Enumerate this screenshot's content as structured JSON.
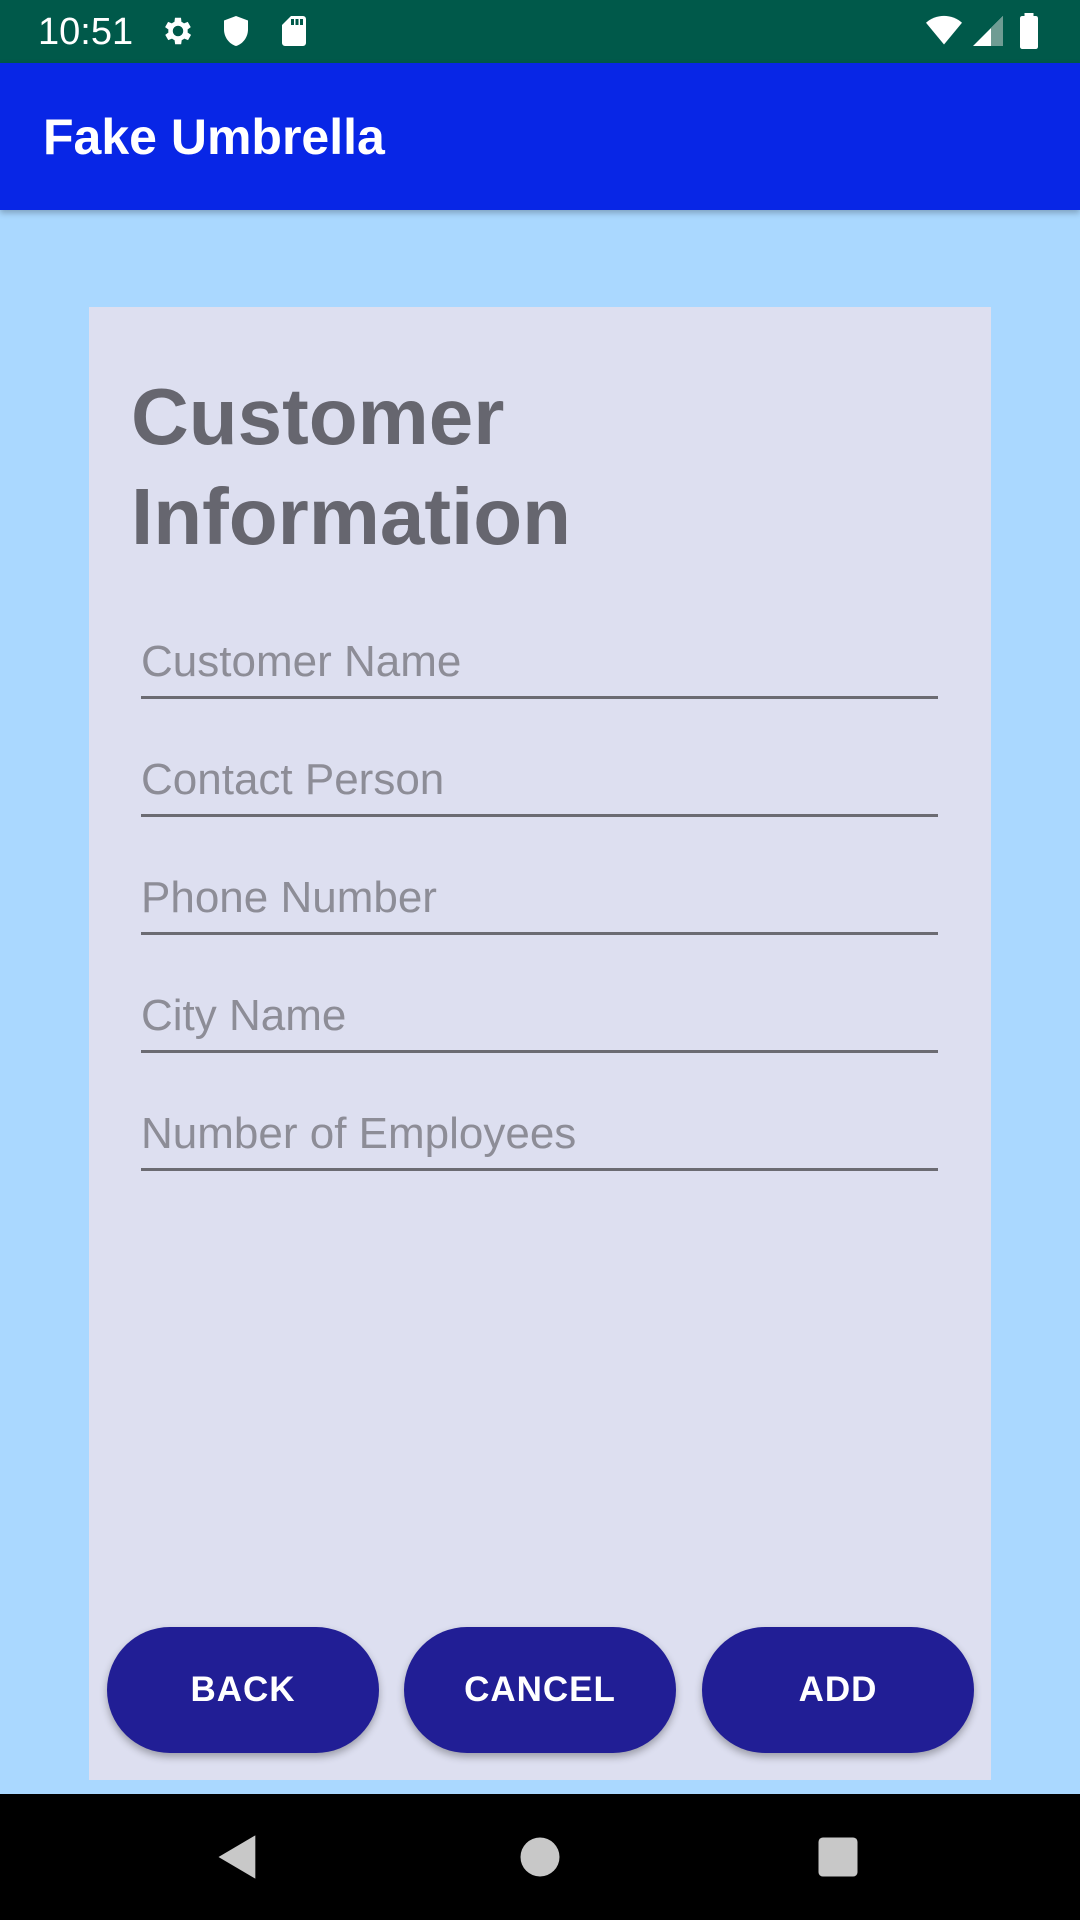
{
  "status_bar": {
    "time": "10:51",
    "icons_left": [
      "settings-icon",
      "shield-icon",
      "sd-card-icon"
    ],
    "icons_right": [
      "wifi-icon",
      "signal-icon",
      "battery-icon"
    ]
  },
  "app_bar": {
    "title": "Fake Umbrella",
    "color": "#0826e6"
  },
  "form": {
    "title": "Customer\nInformation",
    "fields": [
      {
        "name": "customer-name",
        "value": "",
        "placeholder": "Customer Name"
      },
      {
        "name": "contact-person",
        "value": "",
        "placeholder": "Contact Person"
      },
      {
        "name": "phone-number",
        "value": "",
        "placeholder": "Phone Number"
      },
      {
        "name": "city-name",
        "value": "",
        "placeholder": "City Name"
      },
      {
        "name": "number-of-employees",
        "value": "",
        "placeholder": "Number of Employees"
      }
    ],
    "buttons": {
      "back": "BACK",
      "cancel": "CANCEL",
      "add": "ADD"
    },
    "button_color": "#211e95"
  },
  "nav_bar": {
    "icons": [
      "back-icon",
      "home-icon",
      "recents-icon"
    ]
  },
  "colors": {
    "background": "#aad8ff",
    "card": "#dddff0",
    "status_bar": "#00594a"
  }
}
